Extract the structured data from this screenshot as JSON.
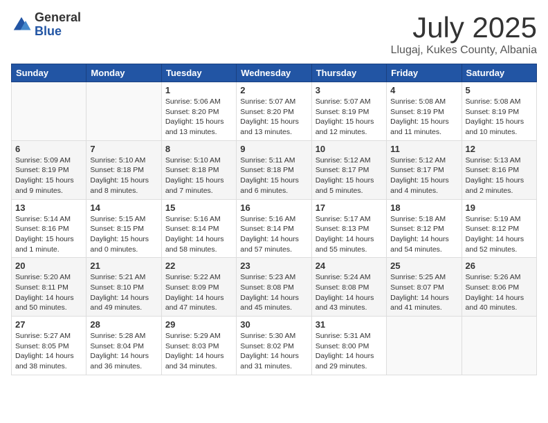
{
  "logo": {
    "general": "General",
    "blue": "Blue"
  },
  "title": "July 2025",
  "subtitle": "Llugaj, Kukes County, Albania",
  "days_of_week": [
    "Sunday",
    "Monday",
    "Tuesday",
    "Wednesday",
    "Thursday",
    "Friday",
    "Saturday"
  ],
  "weeks": [
    [
      {
        "day": "",
        "sunrise": "",
        "sunset": "",
        "daylight": ""
      },
      {
        "day": "",
        "sunrise": "",
        "sunset": "",
        "daylight": ""
      },
      {
        "day": "1",
        "sunrise": "Sunrise: 5:06 AM",
        "sunset": "Sunset: 8:20 PM",
        "daylight": "Daylight: 15 hours and 13 minutes."
      },
      {
        "day": "2",
        "sunrise": "Sunrise: 5:07 AM",
        "sunset": "Sunset: 8:20 PM",
        "daylight": "Daylight: 15 hours and 13 minutes."
      },
      {
        "day": "3",
        "sunrise": "Sunrise: 5:07 AM",
        "sunset": "Sunset: 8:19 PM",
        "daylight": "Daylight: 15 hours and 12 minutes."
      },
      {
        "day": "4",
        "sunrise": "Sunrise: 5:08 AM",
        "sunset": "Sunset: 8:19 PM",
        "daylight": "Daylight: 15 hours and 11 minutes."
      },
      {
        "day": "5",
        "sunrise": "Sunrise: 5:08 AM",
        "sunset": "Sunset: 8:19 PM",
        "daylight": "Daylight: 15 hours and 10 minutes."
      }
    ],
    [
      {
        "day": "6",
        "sunrise": "Sunrise: 5:09 AM",
        "sunset": "Sunset: 8:19 PM",
        "daylight": "Daylight: 15 hours and 9 minutes."
      },
      {
        "day": "7",
        "sunrise": "Sunrise: 5:10 AM",
        "sunset": "Sunset: 8:18 PM",
        "daylight": "Daylight: 15 hours and 8 minutes."
      },
      {
        "day": "8",
        "sunrise": "Sunrise: 5:10 AM",
        "sunset": "Sunset: 8:18 PM",
        "daylight": "Daylight: 15 hours and 7 minutes."
      },
      {
        "day": "9",
        "sunrise": "Sunrise: 5:11 AM",
        "sunset": "Sunset: 8:18 PM",
        "daylight": "Daylight: 15 hours and 6 minutes."
      },
      {
        "day": "10",
        "sunrise": "Sunrise: 5:12 AM",
        "sunset": "Sunset: 8:17 PM",
        "daylight": "Daylight: 15 hours and 5 minutes."
      },
      {
        "day": "11",
        "sunrise": "Sunrise: 5:12 AM",
        "sunset": "Sunset: 8:17 PM",
        "daylight": "Daylight: 15 hours and 4 minutes."
      },
      {
        "day": "12",
        "sunrise": "Sunrise: 5:13 AM",
        "sunset": "Sunset: 8:16 PM",
        "daylight": "Daylight: 15 hours and 2 minutes."
      }
    ],
    [
      {
        "day": "13",
        "sunrise": "Sunrise: 5:14 AM",
        "sunset": "Sunset: 8:16 PM",
        "daylight": "Daylight: 15 hours and 1 minute."
      },
      {
        "day": "14",
        "sunrise": "Sunrise: 5:15 AM",
        "sunset": "Sunset: 8:15 PM",
        "daylight": "Daylight: 15 hours and 0 minutes."
      },
      {
        "day": "15",
        "sunrise": "Sunrise: 5:16 AM",
        "sunset": "Sunset: 8:14 PM",
        "daylight": "Daylight: 14 hours and 58 minutes."
      },
      {
        "day": "16",
        "sunrise": "Sunrise: 5:16 AM",
        "sunset": "Sunset: 8:14 PM",
        "daylight": "Daylight: 14 hours and 57 minutes."
      },
      {
        "day": "17",
        "sunrise": "Sunrise: 5:17 AM",
        "sunset": "Sunset: 8:13 PM",
        "daylight": "Daylight: 14 hours and 55 minutes."
      },
      {
        "day": "18",
        "sunrise": "Sunrise: 5:18 AM",
        "sunset": "Sunset: 8:12 PM",
        "daylight": "Daylight: 14 hours and 54 minutes."
      },
      {
        "day": "19",
        "sunrise": "Sunrise: 5:19 AM",
        "sunset": "Sunset: 8:12 PM",
        "daylight": "Daylight: 14 hours and 52 minutes."
      }
    ],
    [
      {
        "day": "20",
        "sunrise": "Sunrise: 5:20 AM",
        "sunset": "Sunset: 8:11 PM",
        "daylight": "Daylight: 14 hours and 50 minutes."
      },
      {
        "day": "21",
        "sunrise": "Sunrise: 5:21 AM",
        "sunset": "Sunset: 8:10 PM",
        "daylight": "Daylight: 14 hours and 49 minutes."
      },
      {
        "day": "22",
        "sunrise": "Sunrise: 5:22 AM",
        "sunset": "Sunset: 8:09 PM",
        "daylight": "Daylight: 14 hours and 47 minutes."
      },
      {
        "day": "23",
        "sunrise": "Sunrise: 5:23 AM",
        "sunset": "Sunset: 8:08 PM",
        "daylight": "Daylight: 14 hours and 45 minutes."
      },
      {
        "day": "24",
        "sunrise": "Sunrise: 5:24 AM",
        "sunset": "Sunset: 8:08 PM",
        "daylight": "Daylight: 14 hours and 43 minutes."
      },
      {
        "day": "25",
        "sunrise": "Sunrise: 5:25 AM",
        "sunset": "Sunset: 8:07 PM",
        "daylight": "Daylight: 14 hours and 41 minutes."
      },
      {
        "day": "26",
        "sunrise": "Sunrise: 5:26 AM",
        "sunset": "Sunset: 8:06 PM",
        "daylight": "Daylight: 14 hours and 40 minutes."
      }
    ],
    [
      {
        "day": "27",
        "sunrise": "Sunrise: 5:27 AM",
        "sunset": "Sunset: 8:05 PM",
        "daylight": "Daylight: 14 hours and 38 minutes."
      },
      {
        "day": "28",
        "sunrise": "Sunrise: 5:28 AM",
        "sunset": "Sunset: 8:04 PM",
        "daylight": "Daylight: 14 hours and 36 minutes."
      },
      {
        "day": "29",
        "sunrise": "Sunrise: 5:29 AM",
        "sunset": "Sunset: 8:03 PM",
        "daylight": "Daylight: 14 hours and 34 minutes."
      },
      {
        "day": "30",
        "sunrise": "Sunrise: 5:30 AM",
        "sunset": "Sunset: 8:02 PM",
        "daylight": "Daylight: 14 hours and 31 minutes."
      },
      {
        "day": "31",
        "sunrise": "Sunrise: 5:31 AM",
        "sunset": "Sunset: 8:00 PM",
        "daylight": "Daylight: 14 hours and 29 minutes."
      },
      {
        "day": "",
        "sunrise": "",
        "sunset": "",
        "daylight": ""
      },
      {
        "day": "",
        "sunrise": "",
        "sunset": "",
        "daylight": ""
      }
    ]
  ]
}
